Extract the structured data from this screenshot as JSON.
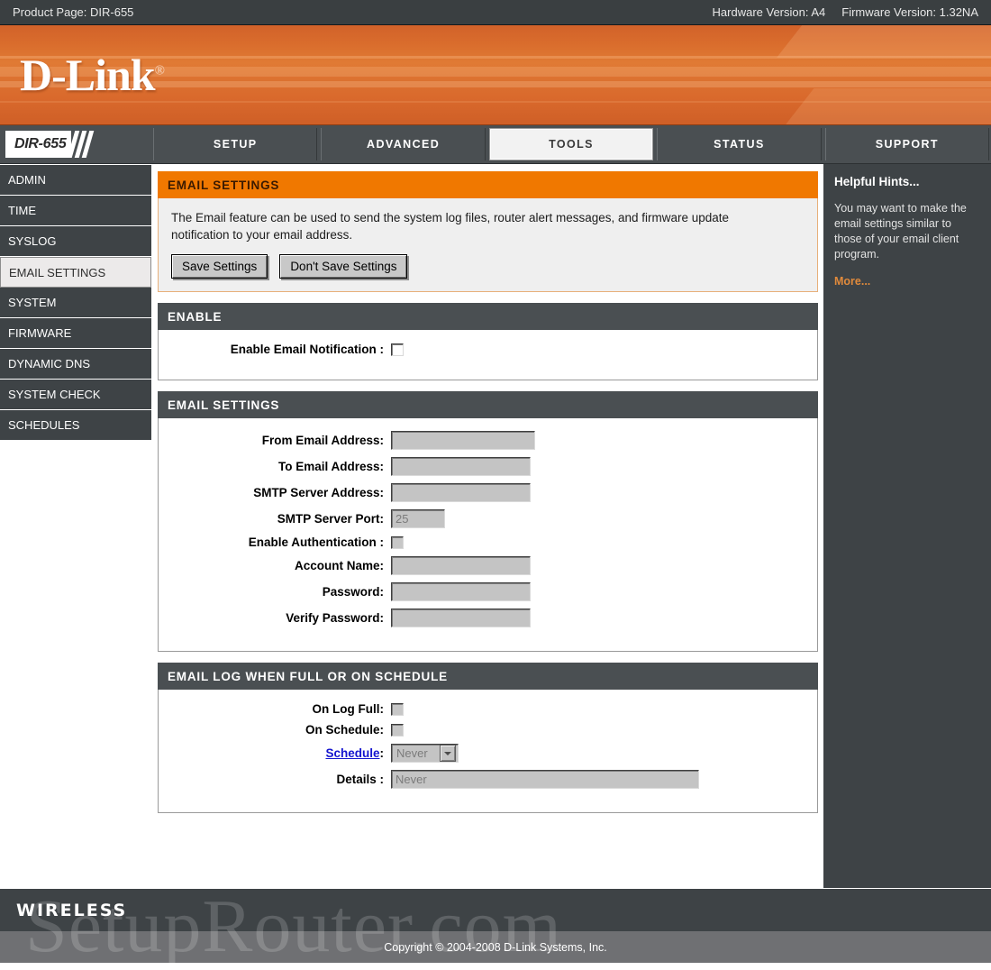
{
  "topbar": {
    "product_page": "Product Page: DIR-655",
    "hardware_version": "Hardware Version: A4",
    "firmware_version": "Firmware Version: 1.32NA"
  },
  "brand": {
    "logo_text": "D-Link",
    "registered_mark": "®"
  },
  "nav": {
    "model": "DIR-655",
    "tabs": [
      {
        "label": "SETUP",
        "active": false
      },
      {
        "label": "ADVANCED",
        "active": false
      },
      {
        "label": "TOOLS",
        "active": true
      },
      {
        "label": "STATUS",
        "active": false
      },
      {
        "label": "SUPPORT",
        "active": false
      }
    ]
  },
  "sidebar": {
    "items": [
      {
        "label": "ADMIN",
        "active": false
      },
      {
        "label": "TIME",
        "active": false
      },
      {
        "label": "SYSLOG",
        "active": false
      },
      {
        "label": "EMAIL SETTINGS",
        "active": true
      },
      {
        "label": "SYSTEM",
        "active": false
      },
      {
        "label": "FIRMWARE",
        "active": false
      },
      {
        "label": "DYNAMIC DNS",
        "active": false
      },
      {
        "label": "SYSTEM CHECK",
        "active": false
      },
      {
        "label": "SCHEDULES",
        "active": false
      }
    ]
  },
  "main": {
    "header_panel": {
      "title": "EMAIL SETTINGS",
      "description": "The Email feature can be used to send the system log files, router alert messages, and firmware update notification to your email address.",
      "save_label": "Save Settings",
      "dont_save_label": "Don't Save Settings"
    },
    "enable_panel": {
      "title": "ENABLE",
      "enable_label": "Enable Email Notification :",
      "enable_checked": false
    },
    "settings_panel": {
      "title": "EMAIL SETTINGS",
      "fields": [
        {
          "label": "From Email Address:",
          "value": ""
        },
        {
          "label": "To Email Address:",
          "value": ""
        },
        {
          "label": "SMTP Server Address:",
          "value": ""
        },
        {
          "label": "SMTP Server Port:",
          "value": "25"
        }
      ],
      "auth_label": "Enable Authentication :",
      "auth_checked": false,
      "auth_fields": [
        {
          "label": "Account Name:",
          "value": ""
        },
        {
          "label": "Password:",
          "value": ""
        },
        {
          "label": "Verify Password:",
          "value": ""
        }
      ]
    },
    "log_panel": {
      "title": "EMAIL LOG WHEN FULL OR ON SCHEDULE",
      "on_log_full_label": "On Log Full:",
      "on_log_full_checked": false,
      "on_schedule_label": "On Schedule:",
      "on_schedule_checked": false,
      "schedule_link_label": "Schedule",
      "schedule_colon": ":",
      "schedule_value": "Never",
      "details_label": "Details :",
      "details_value": "Never"
    }
  },
  "hints": {
    "title": "Helpful Hints...",
    "body": "You may want to make the email settings similar to those of your email client program.",
    "more_label": "More..."
  },
  "footer": {
    "wireless_label": "WIRELESS",
    "copyright": "Copyright © 2004-2008 D-Link Systems, Inc.",
    "watermark": "SetupRouter.com"
  },
  "colors": {
    "brand_orange": "#f07800",
    "panel_dark": "#4a4f52",
    "sidebar_dark": "#3e4346",
    "link_blue": "#1414cf",
    "hint_more_orange": "#e08a3c"
  }
}
